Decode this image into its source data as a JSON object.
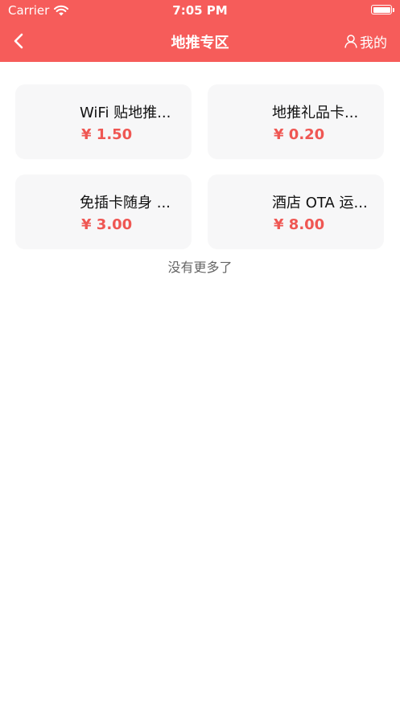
{
  "status_bar": {
    "carrier": "Carrier",
    "time": "7:05 PM"
  },
  "nav": {
    "title": "地推专区",
    "mine_label": "我的"
  },
  "products": [
    {
      "name": "WiFi 贴地推...",
      "price": "¥ 1.50"
    },
    {
      "name": "地推礼品卡...",
      "price": "¥ 0.20"
    },
    {
      "name": "免插卡随身 ...",
      "price": "¥ 3.00"
    },
    {
      "name": "酒店 OTA 运...",
      "price": "¥ 8.00"
    }
  ],
  "footer": {
    "no_more": "没有更多了"
  },
  "colors": {
    "header": "#f65c5a",
    "price": "#ef5753",
    "card_bg": "#f7f7f8"
  },
  "icons": {
    "back": "chevron-left-icon",
    "mine": "user-icon",
    "wifi": "wifi-icon",
    "battery": "battery-icon"
  }
}
